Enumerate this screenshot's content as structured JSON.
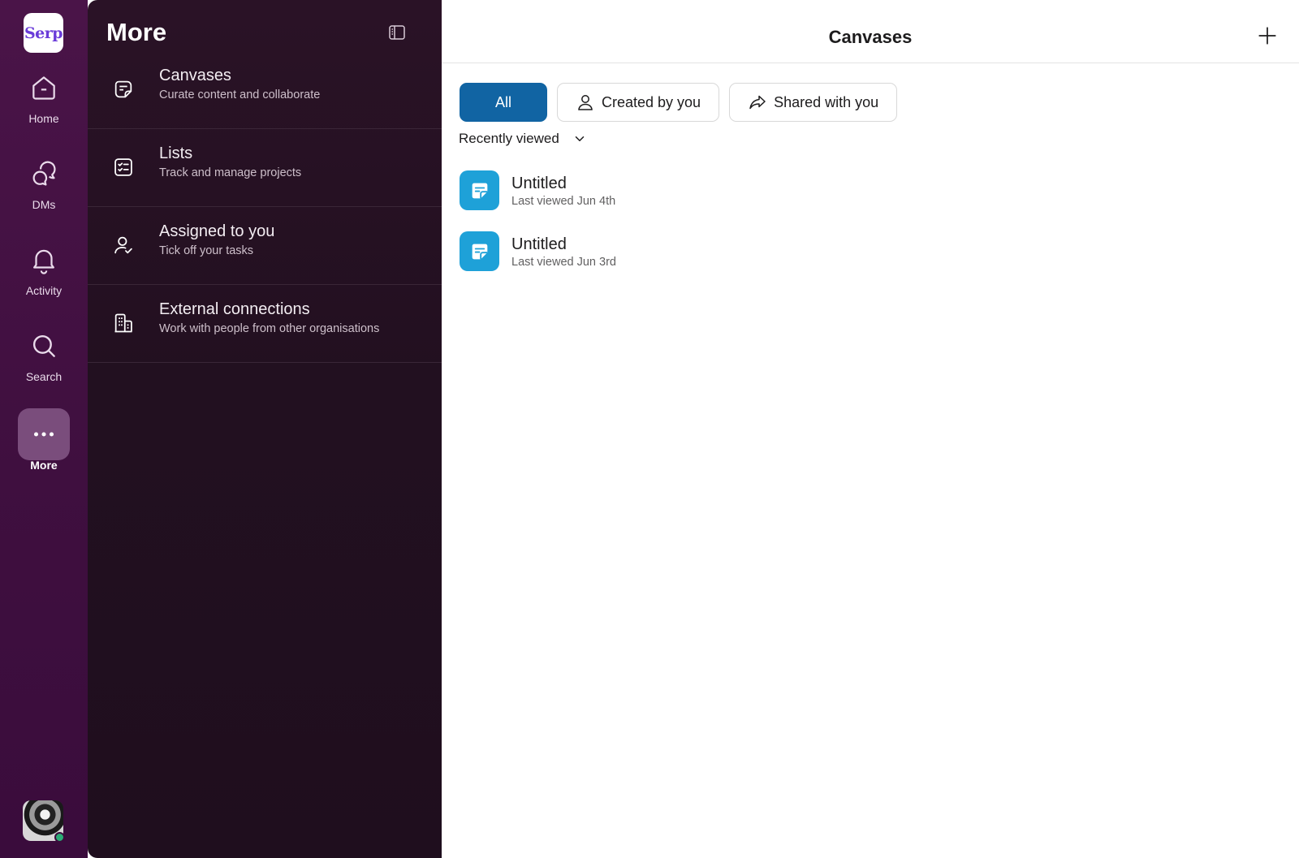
{
  "workspace": {
    "name": "Serp"
  },
  "rail": {
    "items": [
      {
        "label": "Home",
        "icon": "home-icon"
      },
      {
        "label": "DMs",
        "icon": "dms-icon"
      },
      {
        "label": "Activity",
        "icon": "bell-icon"
      },
      {
        "label": "Search",
        "icon": "search-icon"
      },
      {
        "label": "More",
        "icon": "more-icon",
        "active": true
      }
    ]
  },
  "more_panel": {
    "title": "More",
    "items": [
      {
        "title": "Canvases",
        "subtitle": "Curate content and collaborate",
        "icon": "canvas-icon"
      },
      {
        "title": "Lists",
        "subtitle": "Track and manage projects",
        "icon": "list-icon"
      },
      {
        "title": "Assigned to you",
        "subtitle": "Tick off your tasks",
        "icon": "assigned-icon"
      },
      {
        "title": "External connections",
        "subtitle": "Work with people from other organisations",
        "icon": "building-icon"
      }
    ]
  },
  "main": {
    "title": "Canvases",
    "filters": [
      {
        "label": "All",
        "active": true
      },
      {
        "label": "Created by you",
        "icon": "person-icon"
      },
      {
        "label": "Shared with you",
        "icon": "share-icon"
      }
    ],
    "sort_label": "Recently viewed",
    "canvases": [
      {
        "title": "Untitled",
        "subtitle": "Last viewed Jun 4th"
      },
      {
        "title": "Untitled",
        "subtitle": "Last viewed Jun 3rd"
      }
    ]
  },
  "colors": {
    "rail": "#4a1448",
    "panel": "#221020",
    "accent": "#1164a3",
    "canvas_icon": "#1ea1d8",
    "presence": "#2bac76"
  }
}
